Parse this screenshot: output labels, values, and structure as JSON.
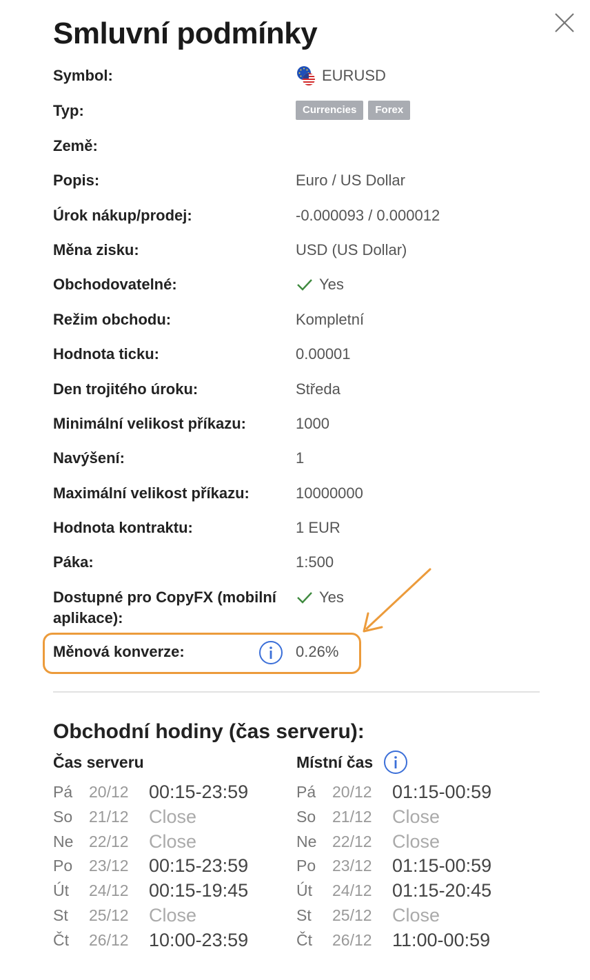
{
  "dialog": {
    "title": "Smluvní podmínky",
    "close_icon": "close-icon"
  },
  "specs": [
    {
      "key": "symbol",
      "label": "Symbol:",
      "value": "EURUSD",
      "icon": "eur-usd-flag-icon"
    },
    {
      "key": "type",
      "label": "Typ:",
      "tags": [
        "Currencies",
        "Forex"
      ]
    },
    {
      "key": "country",
      "label": "Země:",
      "value": ""
    },
    {
      "key": "description",
      "label": "Popis:",
      "value": "Euro / US Dollar"
    },
    {
      "key": "swap",
      "label": "Úrok nákup/prodej:",
      "value": "-0.000093 / 0.000012"
    },
    {
      "key": "profit_currency",
      "label": "Měna zisku:",
      "value": "USD (US Dollar)"
    },
    {
      "key": "tradable",
      "label": "Obchodovatelné:",
      "value": "Yes",
      "icon": "check-icon"
    },
    {
      "key": "trade_mode",
      "label": "Režim obchodu:",
      "value": "Kompletní"
    },
    {
      "key": "tick_value",
      "label": "Hodnota ticku:",
      "value": "0.00001"
    },
    {
      "key": "triple_swap_day",
      "label": "Den trojitého úroku:",
      "value": "Středa"
    },
    {
      "key": "min_order",
      "label": "Minimální velikost příkazu:",
      "value": "1000"
    },
    {
      "key": "step",
      "label": "Navýšení:",
      "value": "1"
    },
    {
      "key": "max_order",
      "label": "Maximální velikost příkazu:",
      "value": "10000000"
    },
    {
      "key": "contract_size",
      "label": "Hodnota kontraktu:",
      "value": "1 EUR"
    },
    {
      "key": "leverage",
      "label": "Páka:",
      "value": "1:500"
    },
    {
      "key": "copyfx",
      "label": "Dostupné pro CopyFX (mobilní aplikace):",
      "value": "Yes",
      "icon": "check-icon"
    },
    {
      "key": "conversion",
      "label": "Měnová konverze:",
      "value": "0.26%",
      "icon": "info-icon"
    }
  ],
  "trading_hours": {
    "title": "Obchodní hodiny (čas serveru):",
    "server_header": "Čas serveru",
    "local_header": "Místní čas",
    "server": [
      {
        "day": "Pá",
        "date": "20/12",
        "time": "00:15-23:59"
      },
      {
        "day": "So",
        "date": "21/12",
        "time": "Close"
      },
      {
        "day": "Ne",
        "date": "22/12",
        "time": "Close"
      },
      {
        "day": "Po",
        "date": "23/12",
        "time": "00:15-23:59"
      },
      {
        "day": "Út",
        "date": "24/12",
        "time": "00:15-19:45"
      },
      {
        "day": "St",
        "date": "25/12",
        "time": "Close"
      },
      {
        "day": "Čt",
        "date": "26/12",
        "time": "10:00-23:59"
      }
    ],
    "local": [
      {
        "day": "Pá",
        "date": "20/12",
        "time": "01:15-00:59"
      },
      {
        "day": "So",
        "date": "21/12",
        "time": "Close"
      },
      {
        "day": "Ne",
        "date": "22/12",
        "time": "Close"
      },
      {
        "day": "Po",
        "date": "23/12",
        "time": "01:15-00:59"
      },
      {
        "day": "Út",
        "date": "24/12",
        "time": "01:15-20:45"
      },
      {
        "day": "St",
        "date": "25/12",
        "time": "Close"
      },
      {
        "day": "Čt",
        "date": "26/12",
        "time": "11:00-00:59"
      }
    ]
  },
  "colors": {
    "highlight": "#ec9b3b",
    "info": "#3b6fd8",
    "check": "#3f8a3f",
    "tag_bg": "#a9acb2"
  }
}
